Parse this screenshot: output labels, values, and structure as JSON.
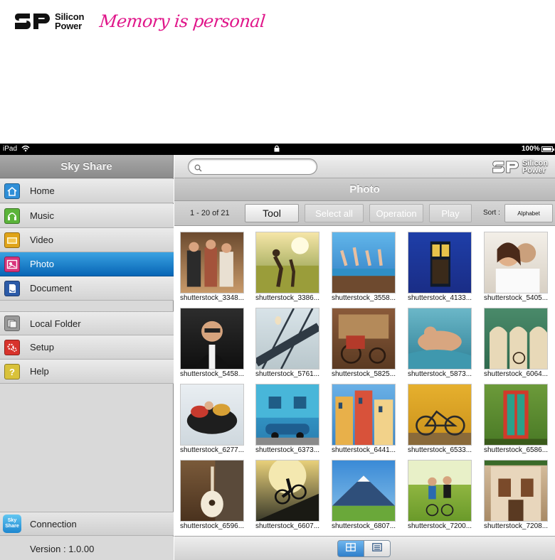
{
  "brand": {
    "logo_text_line1": "Silicon",
    "logo_text_line2": "Power",
    "tagline": "Memory is personal"
  },
  "status_bar": {
    "carrier": "iPad",
    "battery": "100%",
    "battery_level": 1.0
  },
  "sidebar": {
    "title": "Sky Share",
    "items": [
      {
        "label": "Home",
        "icon": "home-icon",
        "color": "#2f8fd8"
      },
      {
        "label": "Music",
        "icon": "headphones-icon",
        "color": "#5bb43a"
      },
      {
        "label": "Video",
        "icon": "video-camera-icon",
        "color": "#e0a419"
      },
      {
        "label": "Photo",
        "icon": "photo-icon",
        "color": "#d8347b"
      },
      {
        "label": "Document",
        "icon": "document-icon",
        "color": "#2c5ba8"
      },
      {
        "label": "Local Folder",
        "icon": "folder-icon",
        "color": "#9a9a9a"
      },
      {
        "label": "Setup",
        "icon": "gear-icon",
        "color": "#d8332c"
      },
      {
        "label": "Help",
        "icon": "help-icon",
        "color": "#d9c23a"
      }
    ],
    "active_item": "Photo",
    "connection_label": "Connection",
    "connection_icon_text": "Sky Share",
    "version": "Version : 1.0.00"
  },
  "main": {
    "search": {
      "value": "",
      "placeholder": ""
    },
    "logo_text_line1": "Silicon",
    "logo_text_line2": "Power",
    "title": "Photo",
    "toolbar": {
      "count": "1 - 20 of 21",
      "tool": "Tool",
      "select_all": "Select all",
      "operation": "Operation",
      "play": "Play",
      "sort_label": "Sort :",
      "sort_value": "Alphabet"
    },
    "photos": [
      {
        "name": "shutterstock_3348...",
        "scene": "people"
      },
      {
        "name": "shutterstock_3386...",
        "scene": "field"
      },
      {
        "name": "shutterstock_3558...",
        "scene": "jump"
      },
      {
        "name": "shutterstock_4133...",
        "scene": "door"
      },
      {
        "name": "shutterstock_5405...",
        "scene": "couple"
      },
      {
        "name": "shutterstock_5458...",
        "scene": "man"
      },
      {
        "name": "shutterstock_5761...",
        "scene": "bridge"
      },
      {
        "name": "shutterstock_5825...",
        "scene": "rickshaw"
      },
      {
        "name": "shutterstock_5873...",
        "scene": "pool"
      },
      {
        "name": "shutterstock_6064...",
        "scene": "arches"
      },
      {
        "name": "shutterstock_6277...",
        "scene": "snow"
      },
      {
        "name": "shutterstock_6373...",
        "scene": "car"
      },
      {
        "name": "shutterstock_6441...",
        "scene": "houses"
      },
      {
        "name": "shutterstock_6533...",
        "scene": "bicycle"
      },
      {
        "name": "shutterstock_6586...",
        "scene": "reddoor"
      },
      {
        "name": "shutterstock_6596...",
        "scene": "guitar"
      },
      {
        "name": "shutterstock_6607...",
        "scene": "biker"
      },
      {
        "name": "shutterstock_6807...",
        "scene": "mountain"
      },
      {
        "name": "shutterstock_7200...",
        "scene": "cyclists"
      },
      {
        "name": "shutterstock_7208...",
        "scene": "building"
      }
    ]
  },
  "view_modes": {
    "active": "grid",
    "grid_icon": "grid-view-icon",
    "list_icon": "list-view-icon"
  }
}
